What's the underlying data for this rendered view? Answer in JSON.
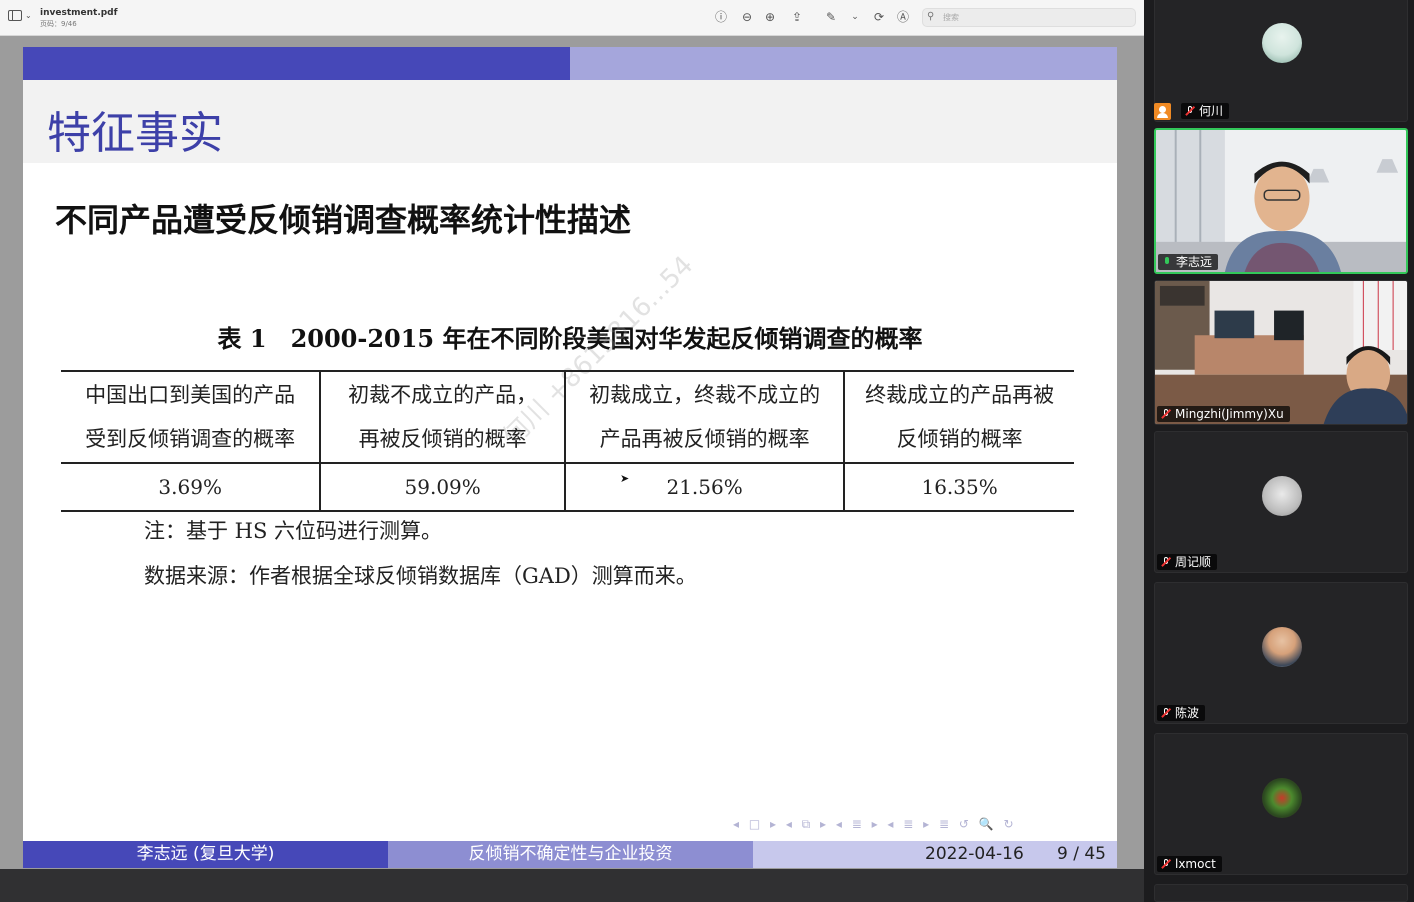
{
  "viewer": {
    "file_name": "investment.pdf",
    "page_indicator": "页码：9/46",
    "search_placeholder": "搜索",
    "toolbar_icons": [
      "sidebar-icon",
      "info-icon",
      "zoom-out-icon",
      "zoom-in-icon",
      "share-icon",
      "markup-icon",
      "rotate-icon",
      "annotate-icon",
      "search-icon"
    ]
  },
  "slide": {
    "title": "特征事实",
    "subtitle": "不同产品遭受反倾销调查概率统计性描述",
    "table_caption": "表 1　2000-2015 年在不同阶段美国对华发起反倾销调查的概率",
    "watermark": "何川 +8613816...54",
    "table": {
      "headers": [
        [
          "中国出口到美国的产品",
          "受到反倾销调查的概率"
        ],
        [
          "初裁不成立的产品，",
          "再被反倾销的概率"
        ],
        [
          "初裁成立，终裁不成立的",
          "产品再被反倾销的概率"
        ],
        [
          "终裁成立的产品再被",
          "反倾销的概率"
        ]
      ],
      "values": [
        "3.69%",
        "59.09%",
        "21.56%",
        "16.35%"
      ]
    },
    "note": "注：基于 HS 六位码进行测算。",
    "source": "数据来源：作者根据全球反倾销数据库（GAD）测算而来。",
    "nav_symbols": "◂ □ ▸ ◂ ⧉ ▸ ◂ ≣ ▸ ◂ ≣ ▸ ≣ ↺ 🔍 ↻",
    "footer": {
      "author": "李志远 (复旦大学)",
      "talk_title": "反倾销不确定性与企业投资",
      "date": "2022-04-16",
      "page": "9 / 45"
    }
  },
  "participants": [
    {
      "name": "何川",
      "mic": "muted",
      "host": true,
      "video": false
    },
    {
      "name": "李志远",
      "mic": "on",
      "host": false,
      "video": true,
      "active_speaker": true
    },
    {
      "name": "Mingzhi(Jimmy)Xu",
      "mic": "muted",
      "host": false,
      "video": true
    },
    {
      "name": "周记顺",
      "mic": "muted",
      "host": false,
      "video": false
    },
    {
      "name": "陈波",
      "mic": "muted",
      "host": false,
      "video": false
    },
    {
      "name": "lxmoct",
      "mic": "muted",
      "host": false,
      "video": false
    }
  ],
  "colors": {
    "accent_dark": "#4648b8",
    "accent_light": "#a5a6dc",
    "active_speaker_border": "#33c85a",
    "host_badge": "#f08a24"
  }
}
